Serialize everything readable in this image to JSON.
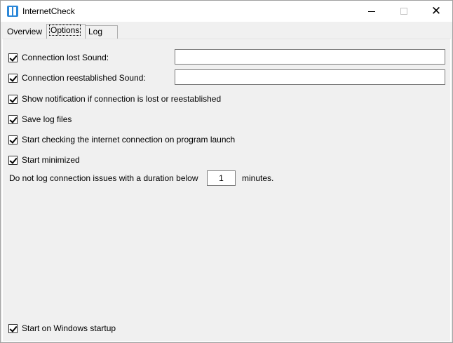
{
  "window": {
    "title": "InternetCheck",
    "app_icon": "app-icon",
    "controls": {
      "minimize_icon": "minimize-icon",
      "maximize_icon": "maximize-icon",
      "close_icon": "close-icon",
      "close_glyph": "✕"
    }
  },
  "tabs": [
    {
      "label": "Overview",
      "selected": false
    },
    {
      "label": "Options",
      "selected": true
    },
    {
      "label": "Log",
      "selected": false
    }
  ],
  "options": {
    "lost_sound": {
      "label": "Connection lost Sound:",
      "checked": true,
      "value": ""
    },
    "reestablished_sound": {
      "label": "Connection reestablished Sound:",
      "checked": true,
      "value": ""
    },
    "show_notification": {
      "label": "Show notification if connection is lost or reestablished",
      "checked": true
    },
    "save_log": {
      "label": "Save log files",
      "checked": true
    },
    "start_checking": {
      "label": "Start checking the internet connection on program launch",
      "checked": true
    },
    "start_minimized": {
      "label": "Start minimized",
      "checked": true
    },
    "min_duration": {
      "prefix": "Do not log connection issues with a duration below",
      "value": "1",
      "suffix": "minutes."
    },
    "windows_startup": {
      "label": "Start on Windows startup",
      "checked": true
    }
  },
  "colors": {
    "accent": "#2b87d8",
    "window_bg": "#f0f0f0",
    "border": "#7a7a7a"
  }
}
